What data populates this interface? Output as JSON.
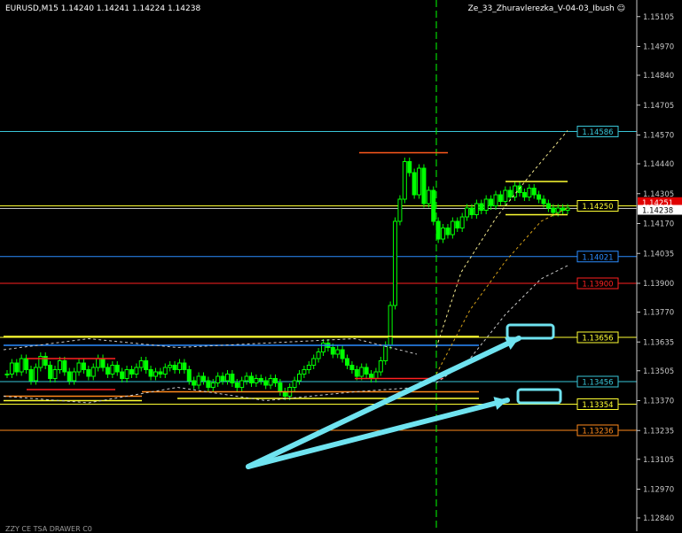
{
  "header": {
    "symbol": "EURUSD,M15",
    "ohlc": "1.14240 1.14241 1.14224 1.14238",
    "expert": "Ze_33_Zhuravlerezka_V-04-03_Ibush",
    "smile_icon": "smiley-face-icon"
  },
  "bottom_note": "ZZY CE TSA DRAWER C0",
  "colors": {
    "background": "#000000",
    "axis": "#c8c8c8",
    "candle": "#00ff00",
    "vline": "#00ff00",
    "arrow": "#6fe3f0",
    "label_cyan": "#39c6d8",
    "label_red": "#ff2020",
    "label_yellow": "#ffff33",
    "label_blue": "#2a8cff",
    "label_orange": "#ff8a1c"
  },
  "chart_data": {
    "type": "candlestick",
    "symbol": "EURUSD",
    "timeframe": "M15",
    "ylim": [
      1.1278,
      1.1518
    ],
    "y_ticks": [
      "1.15105",
      "1.14970",
      "1.14840",
      "1.14705",
      "1.14570",
      "1.14440",
      "1.14305",
      "1.14170",
      "1.14035",
      "1.13900",
      "1.13770",
      "1.13635",
      "1.13505",
      "1.13370",
      "1.13235",
      "1.13105",
      "1.12970",
      "1.12840"
    ],
    "current_price": 1.14238,
    "current_price_label": "1.14238",
    "current_price_label_red": "1.14251",
    "close_series": [
      1.1349,
      1.1354,
      1.135,
      1.1356,
      1.1351,
      1.1346,
      1.1352,
      1.1357,
      1.1353,
      1.1347,
      1.1351,
      1.1355,
      1.135,
      1.1346,
      1.135,
      1.1354,
      1.1351,
      1.1348,
      1.1352,
      1.1356,
      1.1352,
      1.1349,
      1.1353,
      1.135,
      1.1347,
      1.1351,
      1.1349,
      1.1352,
      1.1355,
      1.1351,
      1.1348,
      1.135,
      1.1349,
      1.1352,
      1.1353,
      1.1351,
      1.1354,
      1.1351,
      1.1346,
      1.1344,
      1.1348,
      1.1346,
      1.1343,
      1.1345,
      1.1348,
      1.1346,
      1.1349,
      1.1345,
      1.1343,
      1.1346,
      1.1348,
      1.1345,
      1.1347,
      1.1346,
      1.1344,
      1.1347,
      1.1345,
      1.1341,
      1.1339,
      1.1343,
      1.1346,
      1.1349,
      1.1351,
      1.1353,
      1.1356,
      1.1359,
      1.1363,
      1.1361,
      1.1358,
      1.136,
      1.1356,
      1.1353,
      1.1351,
      1.1348,
      1.1352,
      1.1349,
      1.1347,
      1.135,
      1.1355,
      1.1362,
      1.138,
      1.1418,
      1.1428,
      1.1445,
      1.144,
      1.143,
      1.1442,
      1.1426,
      1.1432,
      1.1418,
      1.141,
      1.1415,
      1.1412,
      1.1418,
      1.1415,
      1.142,
      1.1424,
      1.1421,
      1.1426,
      1.1423,
      1.1428,
      1.1425,
      1.143,
      1.1427,
      1.1432,
      1.1429,
      1.1434,
      1.1431,
      1.1429,
      1.1433,
      1.143,
      1.1428,
      1.1426,
      1.1424,
      1.1422,
      1.1424,
      1.1423,
      1.1424
    ],
    "levels": [
      {
        "price": 1.14586,
        "label": "1.14586",
        "color": "#39c6d8"
      },
      {
        "price": 1.1425,
        "label": "1.14250",
        "color": "#ffff33"
      },
      {
        "price": 1.14021,
        "label": "1.14021",
        "color": "#2a8cff"
      },
      {
        "price": 1.139,
        "label": "1.13900",
        "color": "#ff2020"
      },
      {
        "price": 1.13656,
        "label": "1.13656",
        "color": "#ffff33"
      },
      {
        "price": 1.13456,
        "label": "1.13456",
        "color": "#39c6d8"
      },
      {
        "price": 1.13354,
        "label": "1.13354",
        "color": "#ffff33"
      },
      {
        "price": 1.13236,
        "label": "1.13236",
        "color": "#ff8a1c"
      }
    ],
    "grid": false
  }
}
